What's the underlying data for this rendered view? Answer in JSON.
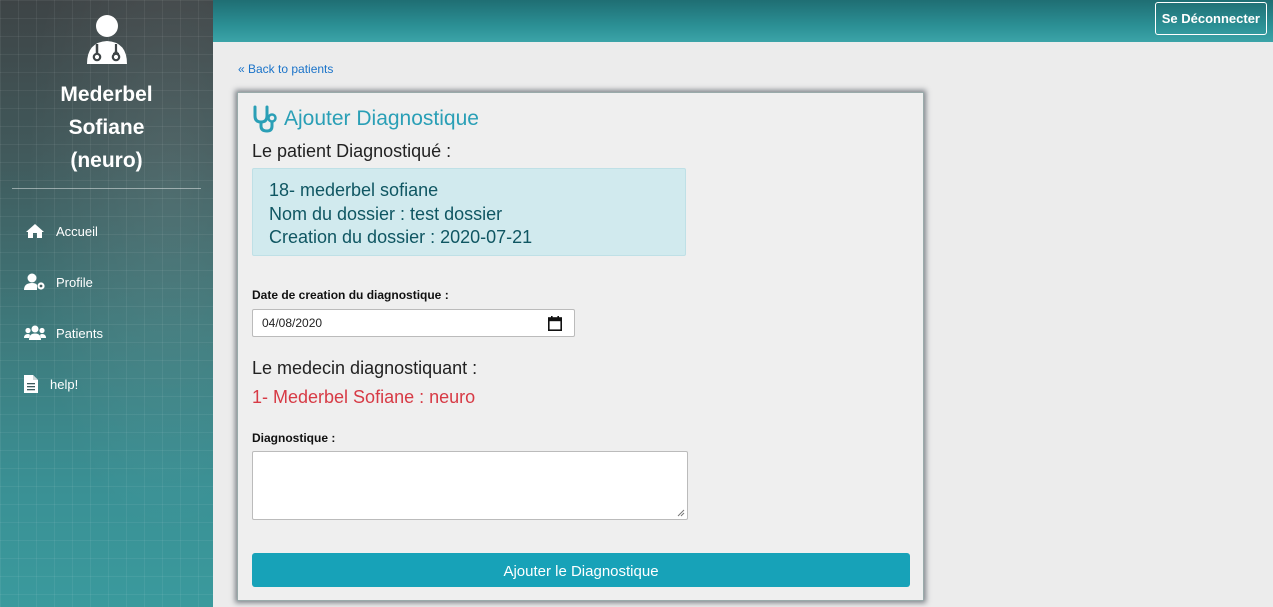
{
  "sidebar": {
    "doctor_name_line1": "Mederbel",
    "doctor_name_line2": "Sofiane",
    "doctor_name_line3": "(neuro)",
    "avatar_icon": "user-md-icon",
    "items": [
      {
        "label": "Accueil",
        "icon": "home-icon"
      },
      {
        "label": "Profile",
        "icon": "user-cog-icon"
      },
      {
        "label": "Patients",
        "icon": "users-icon"
      },
      {
        "label": "help!",
        "icon": "file-icon"
      }
    ]
  },
  "topbar": {
    "logout_label": "Se Déconnecter"
  },
  "back_link": "« Back to patients",
  "card": {
    "title": "Ajouter Diagnostique",
    "title_icon": "stethoscope-icon",
    "patient_label": "Le patient Diagnostiqué :",
    "patient_line1": "18- mederbel sofiane",
    "patient_line2": "Nom du dossier : test dossier",
    "patient_line3": "Creation du dossier : 2020-07-21",
    "date_label": "Date de creation du diagnostique :",
    "date_value": "04/08/2020",
    "medecin_label": "Le medecin diagnostiquant :",
    "medecin_value": "1- Mederbel Sofiane : neuro",
    "diag_label": "Diagnostique :",
    "diag_value": "",
    "submit_label": "Ajouter le Diagnostique"
  },
  "colors": {
    "accent": "#17a2b8",
    "title": "#2a9fb6",
    "danger": "#d73a45",
    "info_bg": "#d1eaee"
  }
}
